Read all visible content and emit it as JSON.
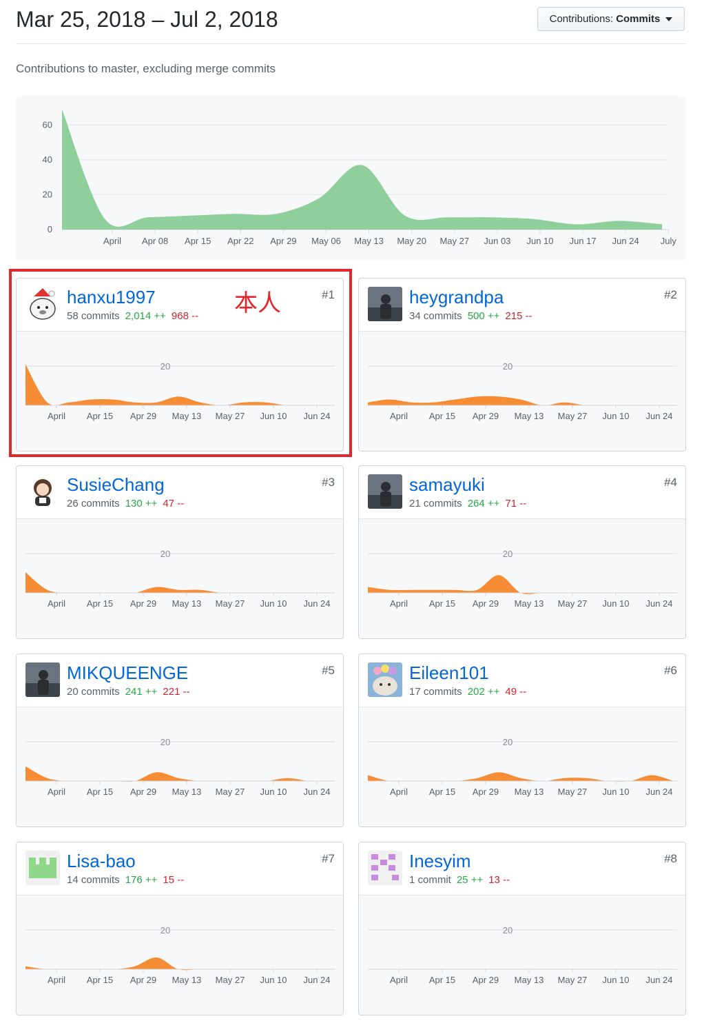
{
  "header": {
    "date_range": "Mar 25, 2018 – Jul 2, 2018",
    "contributions_button_prefix": "Contributions:",
    "contributions_button_value": "Commits",
    "subtitle": "Contributions to master, excluding merge commits"
  },
  "annotation": "本人",
  "colors": {
    "main_fill": "#8ecf9b",
    "card_fill": "#f68c33",
    "link": "#0366d6",
    "add": "#28a745",
    "del": "#cb2431",
    "highlight": "#e3262b"
  },
  "chart_data": [
    {
      "type": "area",
      "x": [
        "Mar 25",
        "Apr 01",
        "Apr 08",
        "Apr 15",
        "Apr 22",
        "Apr 29",
        "May 06",
        "May 13",
        "May 20",
        "May 27",
        "Jun 03",
        "Jun 10",
        "Jun 17",
        "Jun 24",
        "Jul 01"
      ],
      "values": [
        69,
        6,
        7,
        8,
        9,
        9,
        18,
        37,
        8,
        7,
        7,
        6,
        3,
        5,
        3
      ],
      "x_tick_labels": [
        "April",
        "Apr 08",
        "Apr 15",
        "Apr 22",
        "Apr 29",
        "May 06",
        "May 13",
        "May 20",
        "May 27",
        "Jun 03",
        "Jun 10",
        "Jun 17",
        "Jun 24",
        "July"
      ],
      "y_tick_labels": [
        "0",
        "20",
        "40",
        "60"
      ],
      "ylim": [
        0,
        70
      ],
      "grid": true
    }
  ],
  "cards": [
    {
      "username": "hanxu1997",
      "commits": "58 commits",
      "additions": "2,014 ++",
      "deletions": "968 --",
      "rank": "#1",
      "avatar_icon": "bear-avatar-icon",
      "values": [
        14,
        1,
        1,
        2,
        2,
        1,
        1,
        3,
        1,
        0,
        1,
        1,
        0,
        0,
        0
      ]
    },
    {
      "username": "heygrandpa",
      "commits": "34 commits",
      "additions": "500 ++",
      "deletions": "215 --",
      "rank": "#2",
      "avatar_icon": "photo-avatar-icon",
      "values": [
        1,
        2,
        1,
        1,
        2,
        3,
        3,
        2,
        0,
        1,
        0,
        0,
        0,
        0,
        0
      ]
    },
    {
      "username": "SusieChang",
      "commits": "26 commits",
      "additions": "130 ++",
      "deletions": "47 --",
      "rank": "#3",
      "avatar_icon": "cartoon-avatar-icon",
      "values": [
        7,
        1,
        0,
        0,
        0,
        0,
        2,
        1,
        1,
        0,
        0,
        0,
        0,
        0,
        0
      ]
    },
    {
      "username": "samayuki",
      "commits": "21 commits",
      "additions": "264 ++",
      "deletions": "71 --",
      "rank": "#4",
      "avatar_icon": "photo-avatar-icon",
      "values": [
        2,
        1,
        1,
        1,
        1,
        1,
        6,
        0,
        0,
        0,
        0,
        0,
        0,
        0,
        0
      ]
    },
    {
      "username": "MIKQUEENGE",
      "commits": "20 commits",
      "additions": "241 ++",
      "deletions": "221 --",
      "rank": "#5",
      "avatar_icon": "photo-avatar-icon",
      "values": [
        5,
        1,
        0,
        0,
        0,
        0,
        3,
        1,
        0,
        0,
        0,
        0,
        1,
        0,
        0
      ]
    },
    {
      "username": "Eileen101",
      "commits": "17 commits",
      "additions": "202 ++",
      "deletions": "49 --",
      "rank": "#6",
      "avatar_icon": "cat-avatar-icon",
      "values": [
        2,
        0,
        0,
        0,
        0,
        1,
        3,
        1,
        0,
        1,
        1,
        0,
        0,
        2,
        0
      ]
    },
    {
      "username": "Lisa-bao",
      "commits": "14 commits",
      "additions": "176 ++",
      "deletions": "15 --",
      "rank": "#7",
      "avatar_icon": "identicon-green-icon",
      "values": [
        1,
        0,
        0,
        0,
        0,
        1,
        4,
        0,
        0,
        0,
        0,
        0,
        0,
        0,
        0
      ]
    },
    {
      "username": "Inesyim",
      "commits": "1 commit",
      "additions": "25 ++",
      "deletions": "13 --",
      "rank": "#8",
      "avatar_icon": "identicon-purple-icon",
      "values": [
        0,
        0,
        0,
        0,
        0,
        0,
        0,
        0,
        0,
        0,
        0,
        0,
        0,
        0,
        0
      ]
    }
  ],
  "card_axis": {
    "x_tick_labels": [
      "April",
      "Apr 15",
      "Apr 29",
      "May 13",
      "May 27",
      "Jun 10",
      "Jun 24"
    ],
    "y_tick_label": "20",
    "ylim": [
      0,
      20
    ]
  }
}
